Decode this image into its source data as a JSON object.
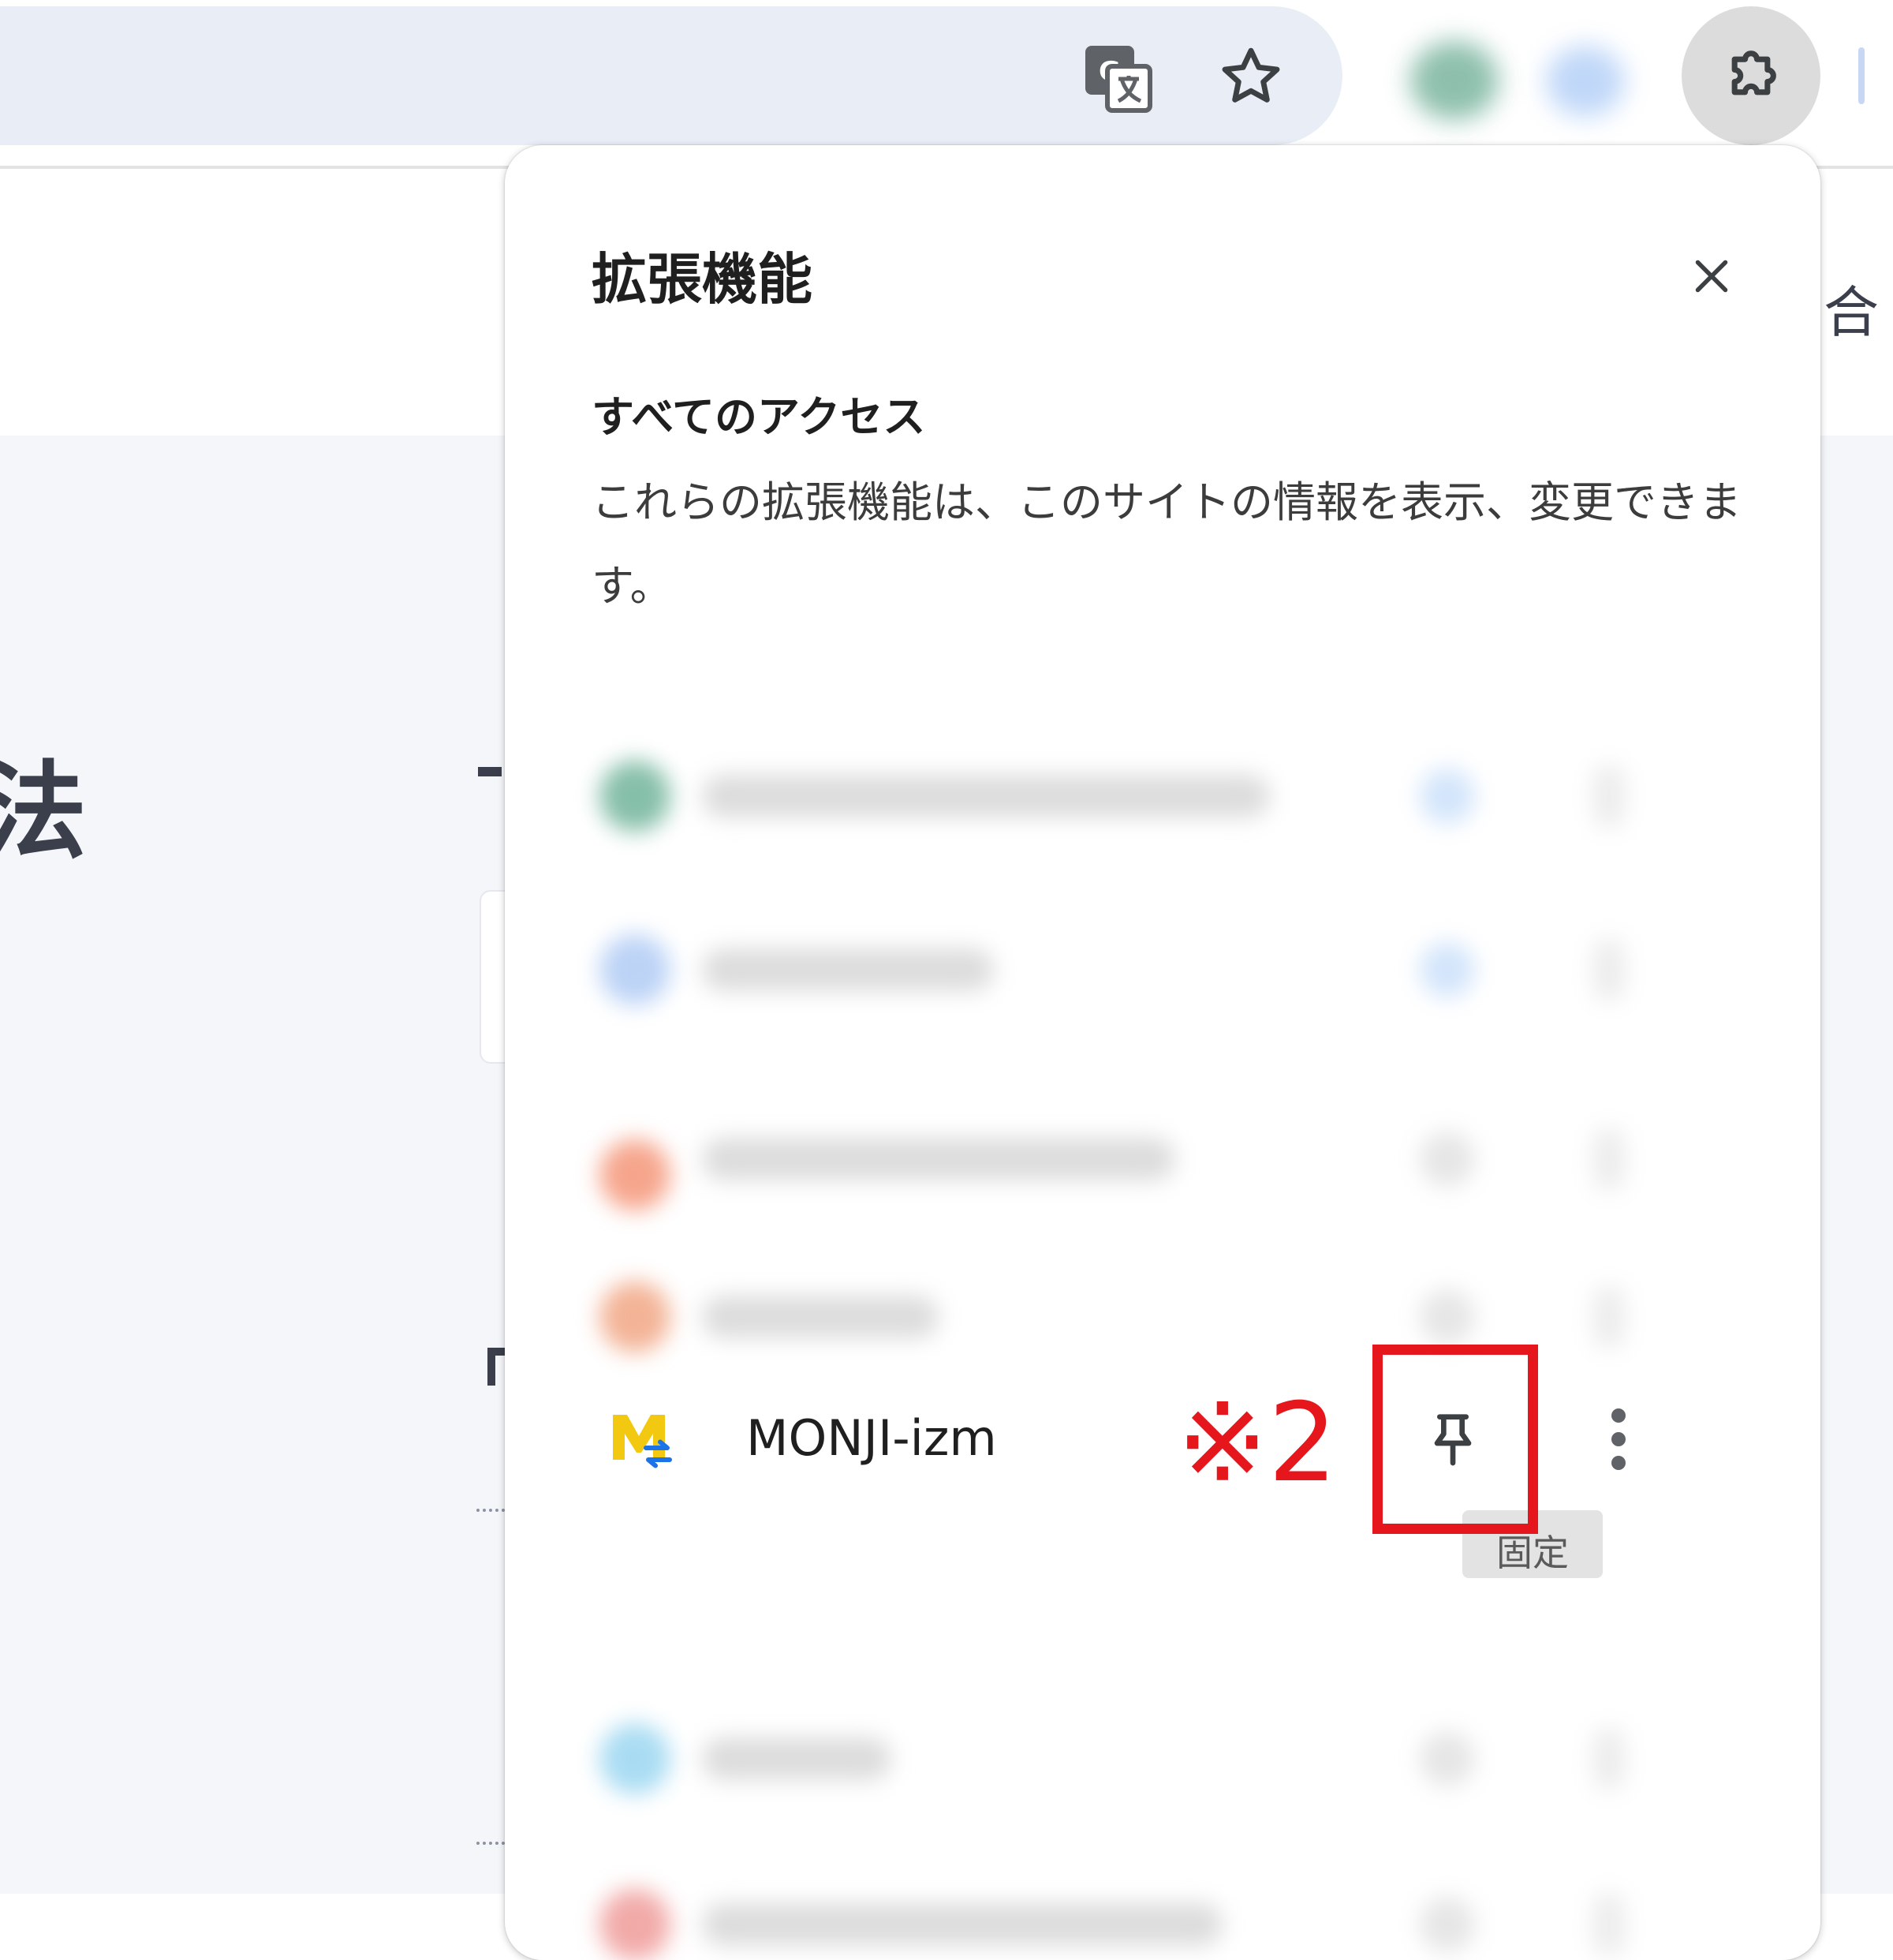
{
  "toolbar": {
    "icons": [
      "translate-icon",
      "star-icon",
      "extension-icon",
      "extensions-puzzle-icon"
    ]
  },
  "page": {
    "heading": "法",
    "side_text": "合"
  },
  "extensions_popup": {
    "title": "拡張機能",
    "close_icon": "close-icon",
    "section_title": "すべてのアクセス",
    "section_description": "これらの拡張機能は、このサイトの情報を表示、変更できます。",
    "items": [
      {
        "name": "MONJI-izm",
        "pin_icon": "pin-icon",
        "more_icon": "more-vert-icon",
        "tooltip": "固定"
      }
    ]
  },
  "annotation": {
    "label": "※2",
    "color": "#e5161c"
  }
}
